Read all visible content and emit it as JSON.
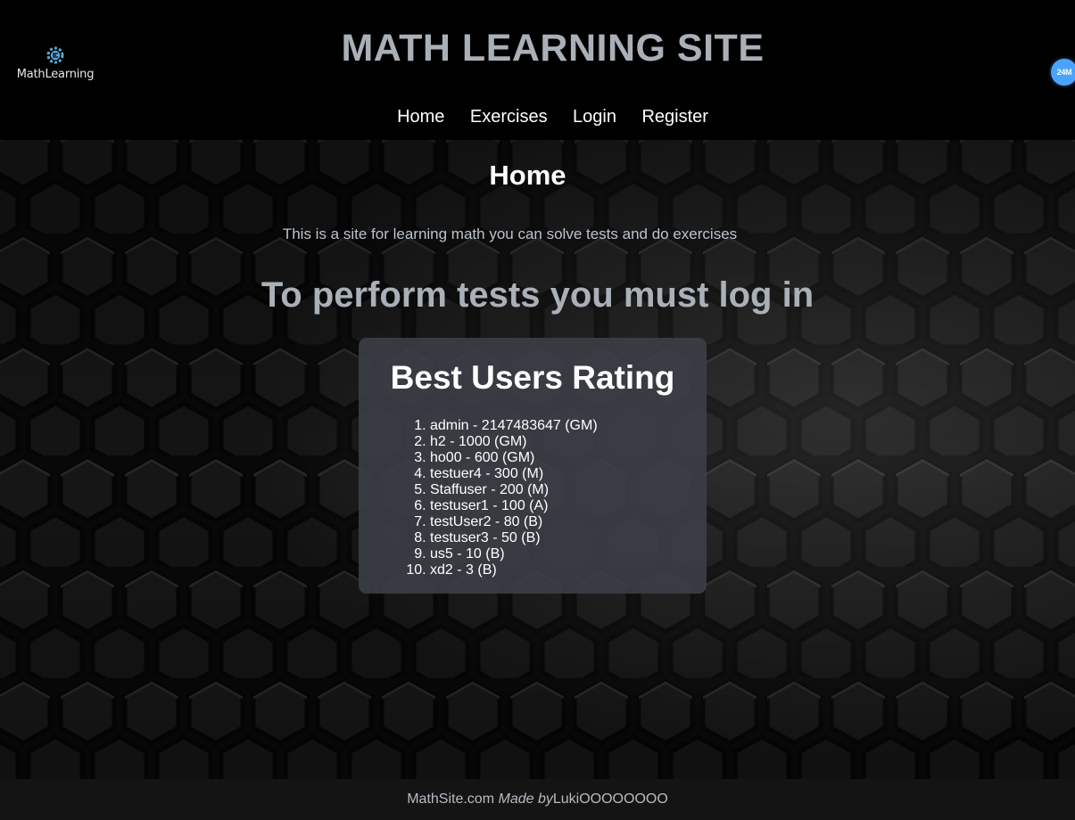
{
  "header": {
    "logo_text": "MathLearning",
    "title": "MATH LEARNING SITE",
    "badge": "24M"
  },
  "nav": {
    "items": [
      {
        "label": "Home"
      },
      {
        "label": "Exercises"
      },
      {
        "label": "Login"
      },
      {
        "label": "Register"
      }
    ]
  },
  "main": {
    "heading": "Home",
    "intro": "This is a site for learning math you can solve tests and do exercises",
    "login_message": "To perform tests you must log in",
    "rating": {
      "title": "Best Users Rating",
      "users": [
        "admin - 2147483647 (GM)",
        "h2 - 1000 (GM)",
        "ho00 - 600 (GM)",
        "testuer4 - 300 (M)",
        "Staffuser - 200 (M)",
        "testuser1 - 100 (A)",
        "testUser2 - 80 (B)",
        "testuser3 - 50 (B)",
        "us5 - 10 (B)",
        "xd2 - 3 (B)"
      ]
    }
  },
  "footer": {
    "site": "MathSite.com ",
    "made_by": "Made by",
    "author": "LukiOOOOOOOO"
  },
  "colors": {
    "title": "#a9b0b8",
    "badge": "#4aa3ff",
    "card": "#3c4048"
  }
}
